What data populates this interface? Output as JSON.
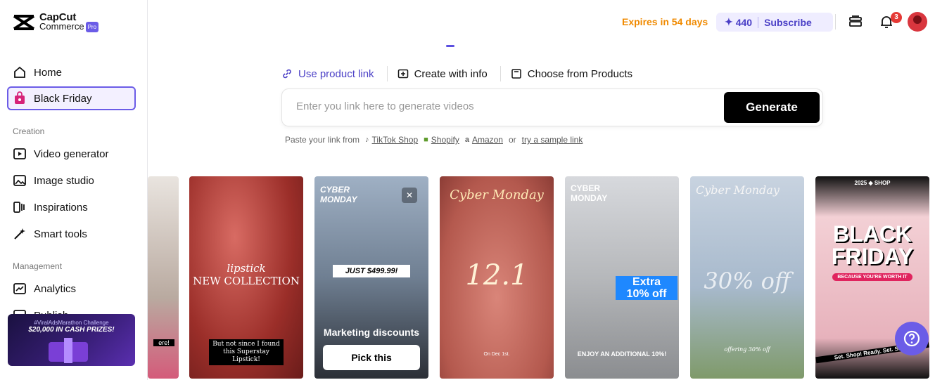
{
  "brand": {
    "line1": "CapCut",
    "line2": "Commerce",
    "pro": "Pro"
  },
  "sidebar": {
    "items": [
      {
        "label": "Home",
        "icon": "home-icon"
      },
      {
        "label": "Black Friday",
        "icon": "shopping-bag-icon",
        "active": true
      }
    ],
    "creation_title": "Creation",
    "creation": [
      {
        "label": "Video generator",
        "icon": "video-generator-icon"
      },
      {
        "label": "Image studio",
        "icon": "image-studio-icon"
      },
      {
        "label": "Inspirations",
        "icon": "inspirations-icon"
      },
      {
        "label": "Smart tools",
        "icon": "smart-tools-icon"
      }
    ],
    "management_title": "Management",
    "management": [
      {
        "label": "Analytics",
        "icon": "analytics-icon"
      },
      {
        "label": "Publish",
        "icon": "publish-icon"
      }
    ],
    "promo": {
      "line1": "#ViralAdsMarathon Challenge",
      "line2": "$20,000 IN CASH PRIZES!"
    }
  },
  "topbar": {
    "expires": "Expires in 54 days",
    "credits": "440",
    "subscribe": "Subscribe",
    "notifications": "3"
  },
  "tabs": [
    "Use product link",
    "Create with info",
    "Choose from Products"
  ],
  "input": {
    "placeholder": "Enter you link here to generate videos",
    "button": "Generate"
  },
  "paste": {
    "prefix": "Paste your link from",
    "tiktok": "TikTok Shop",
    "shopify": "Shopify",
    "amazon": "Amazon",
    "or": "or",
    "sample": "try a sample link"
  },
  "cards": {
    "c0": {
      "caption": "ere!"
    },
    "c1": {
      "title1": "lipstick",
      "title2": "NEW COLLECTION",
      "caption": "But not since I found this Superstay Lipstick!"
    },
    "c2": {
      "title": "CYBER MONDAY",
      "price": "JUST $499.99!",
      "label": "Marketing discounts",
      "button": "Pick this"
    },
    "c3": {
      "title": "Cyber Monday",
      "big": "12.1",
      "small": "On Dec 1st."
    },
    "c4": {
      "title": "CYBER MONDAY",
      "offer1": "Extra",
      "offer2": "10% off",
      "caption": "ENJOY AN ADDITIONAL 10%!"
    },
    "c5": {
      "title": "Cyber Monday",
      "big": "30% off",
      "small": "offering 30% off"
    },
    "c6": {
      "top": "2025 ◆ SHOP",
      "title1": "BLACK",
      "title2": "FRIDAY",
      "tag": "BECAUSE YOU'RE WORTH IT",
      "ribbon": "Set. Shop! Ready. Set. Shop!"
    }
  }
}
